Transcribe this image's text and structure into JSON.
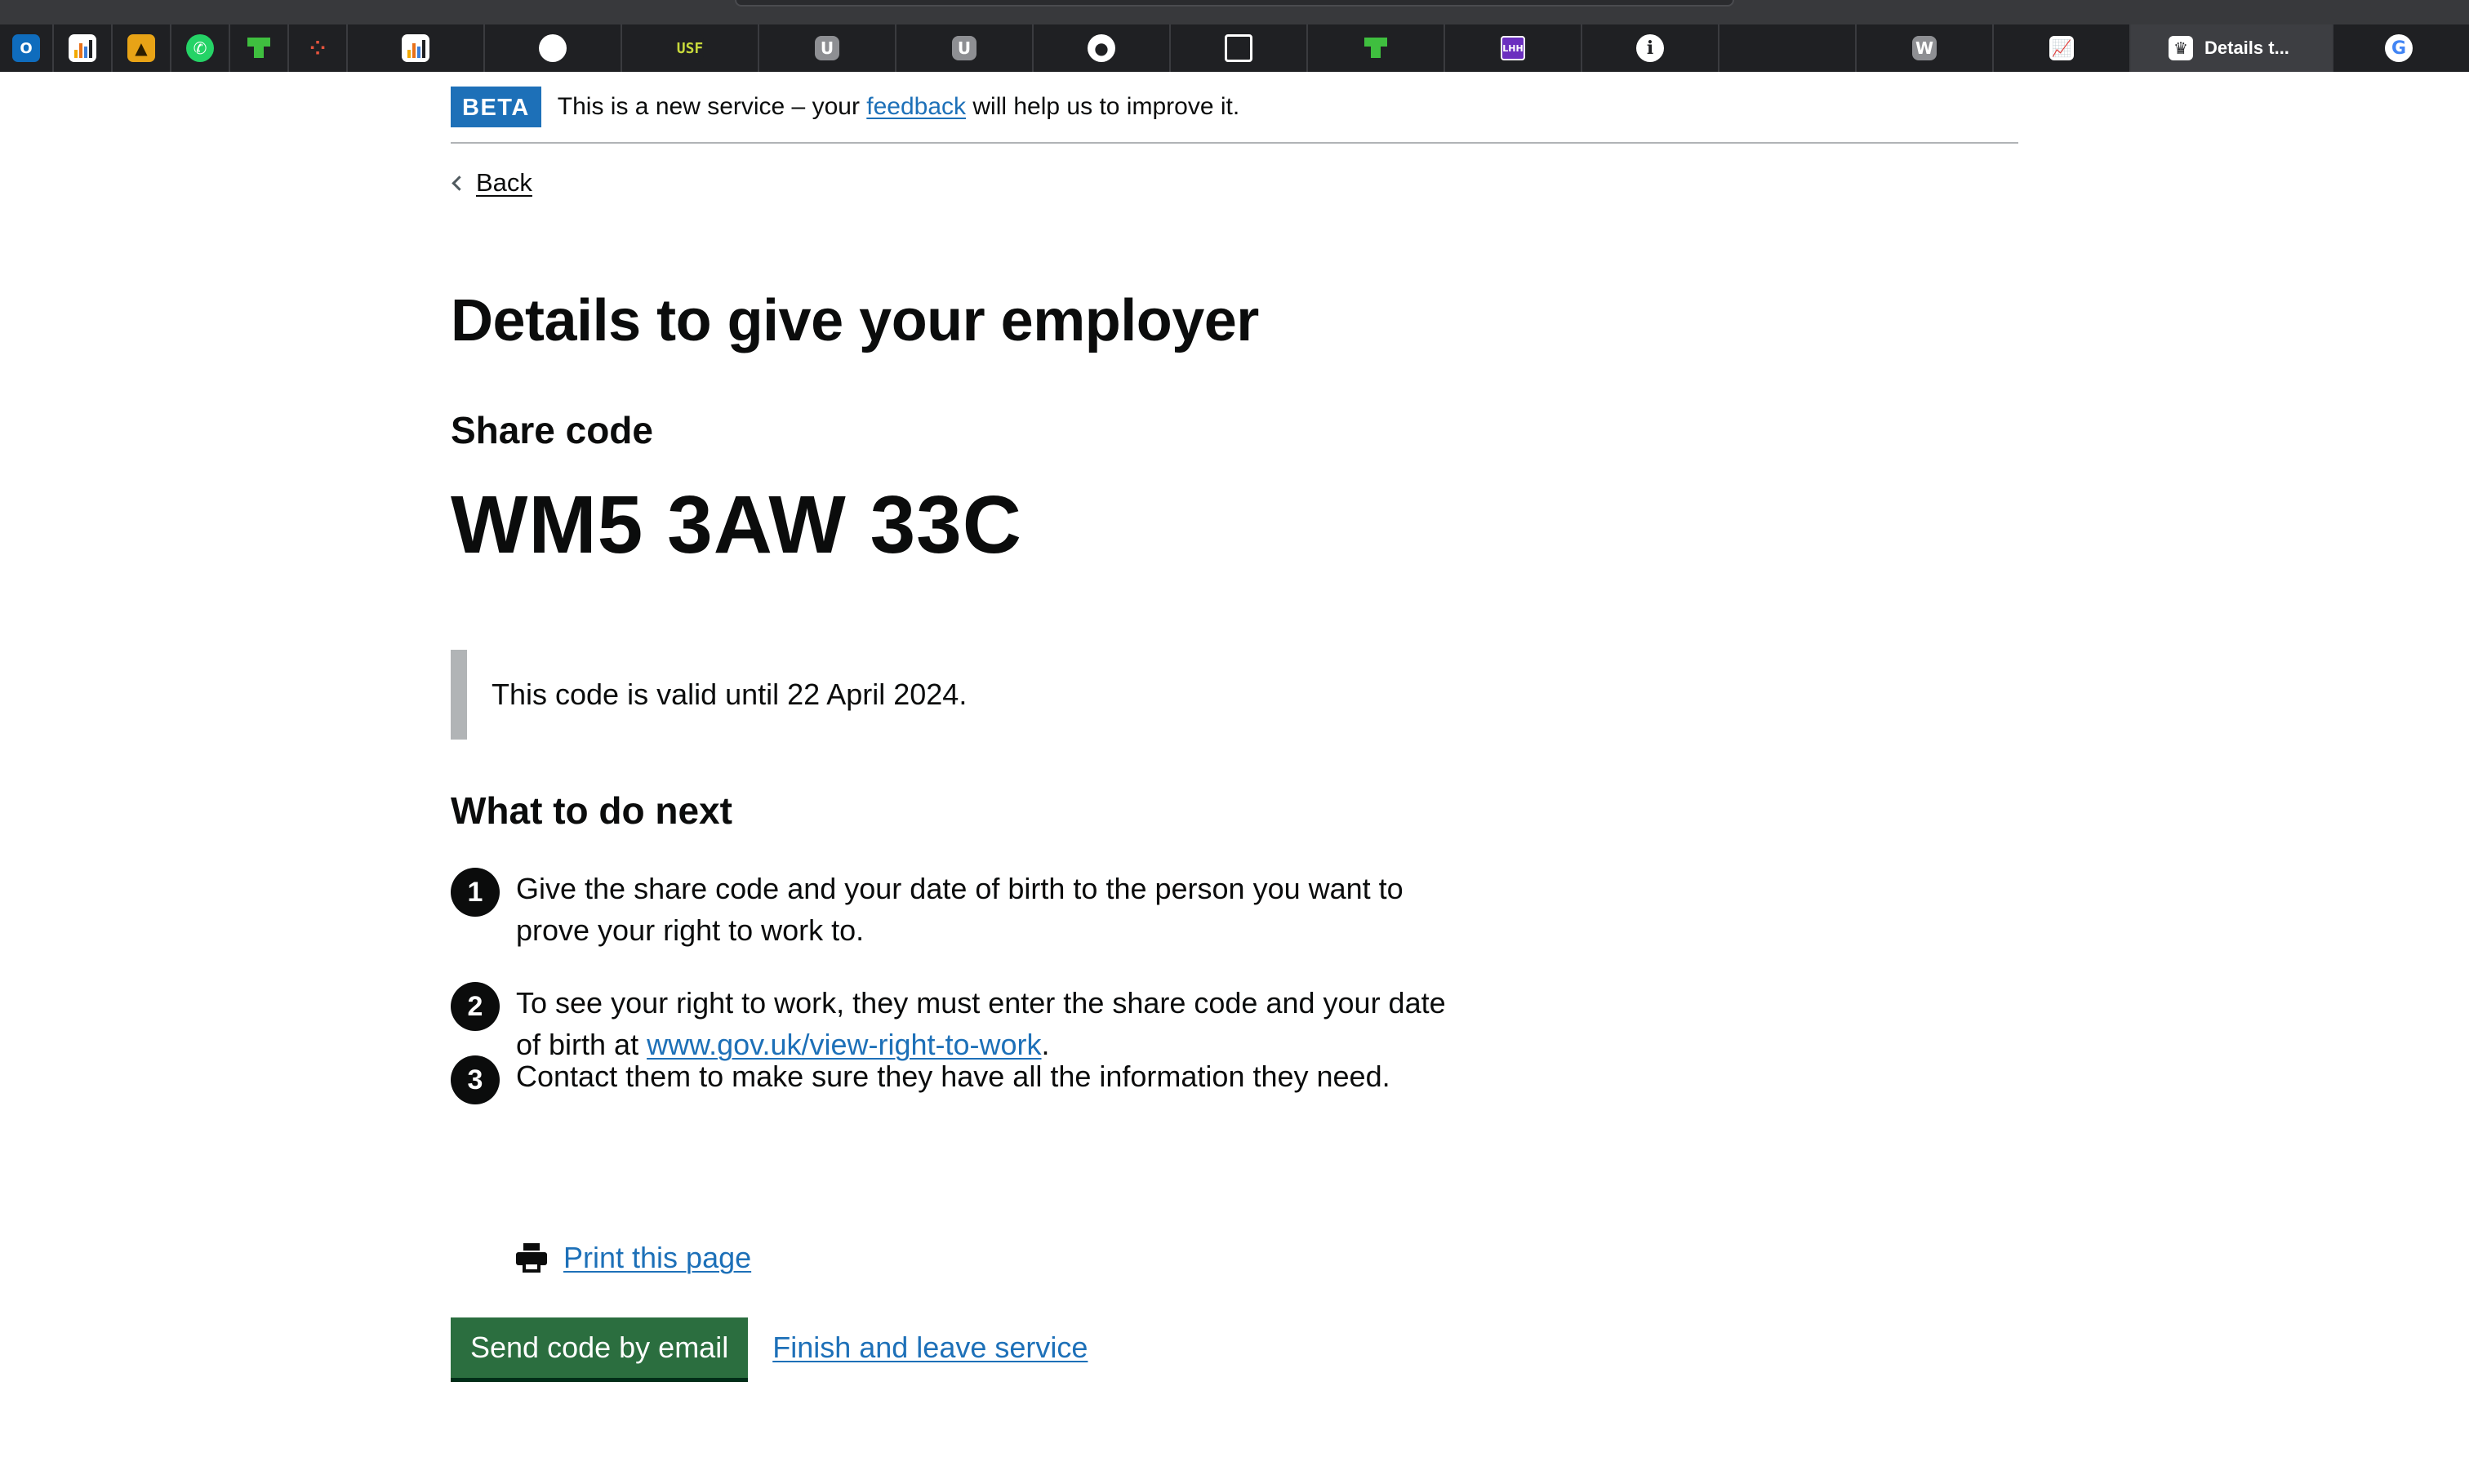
{
  "browser": {
    "tabs": [
      {
        "icon": "outlook-icon",
        "glyph": "O"
      },
      {
        "icon": "bar-chart-icon",
        "glyph": ""
      },
      {
        "icon": "orange-app-icon",
        "glyph": "▲"
      },
      {
        "icon": "whatsapp-icon",
        "glyph": "✆"
      },
      {
        "icon": "green-t-icon",
        "glyph": ""
      },
      {
        "icon": "dotted-chart-icon",
        "glyph": "⁘"
      },
      {
        "icon": "bar-chart-icon",
        "glyph": ""
      },
      {
        "icon": "apple-icon",
        "glyph": ""
      },
      {
        "icon": "usf-icon",
        "glyph": "USF"
      },
      {
        "icon": "u-icon",
        "glyph": "U"
      },
      {
        "icon": "u-icon",
        "glyph": "U"
      },
      {
        "icon": "github-icon",
        "glyph": "●"
      },
      {
        "icon": "grid-icon",
        "glyph": ""
      },
      {
        "icon": "green-t-icon",
        "glyph": ""
      },
      {
        "icon": "lhh-icon",
        "glyph": "LHH"
      },
      {
        "icon": "info-icon",
        "glyph": "i"
      },
      {
        "icon": "blank-tab",
        "glyph": ""
      },
      {
        "icon": "w-icon",
        "glyph": "W"
      },
      {
        "icon": "blue-chart-icon",
        "glyph": "📈"
      },
      {
        "icon": "crown-icon",
        "glyph": "♛",
        "title": "Details t...",
        "active": true
      },
      {
        "icon": "google-icon",
        "glyph": "G"
      }
    ]
  },
  "phase_banner": {
    "tag": "BETA",
    "text_before": "This is a new service – your ",
    "link": "feedback",
    "text_after": " will help us to improve it."
  },
  "back_link": "Back",
  "title": "Details to give your employer",
  "share_code_label": "Share code",
  "share_code": "WM5 3AW 33C",
  "validity": "This code is valid until 22 April 2024.",
  "next_heading": "What to do next",
  "steps": [
    {
      "number": "1",
      "text": "Give the share code and your date of birth to the person you want to prove your right to work to."
    },
    {
      "number": "2",
      "text_before": "To see your right to work, they must enter the share code and your date of birth at ",
      "link": "www.gov.uk/view-right-to-work",
      "text_after": "."
    },
    {
      "number": "3",
      "text": "Contact them to make sure they have all the information they need."
    }
  ],
  "print_link": "Print this page",
  "actions": {
    "primary_button": "Send code by email",
    "secondary_link": "Finish and leave service"
  },
  "colors": {
    "link": "#1d70b8",
    "button": "#00703c",
    "beta_tag": "#1d70b8",
    "text": "#0b0c0c",
    "inset_border": "#b1b4b6"
  }
}
